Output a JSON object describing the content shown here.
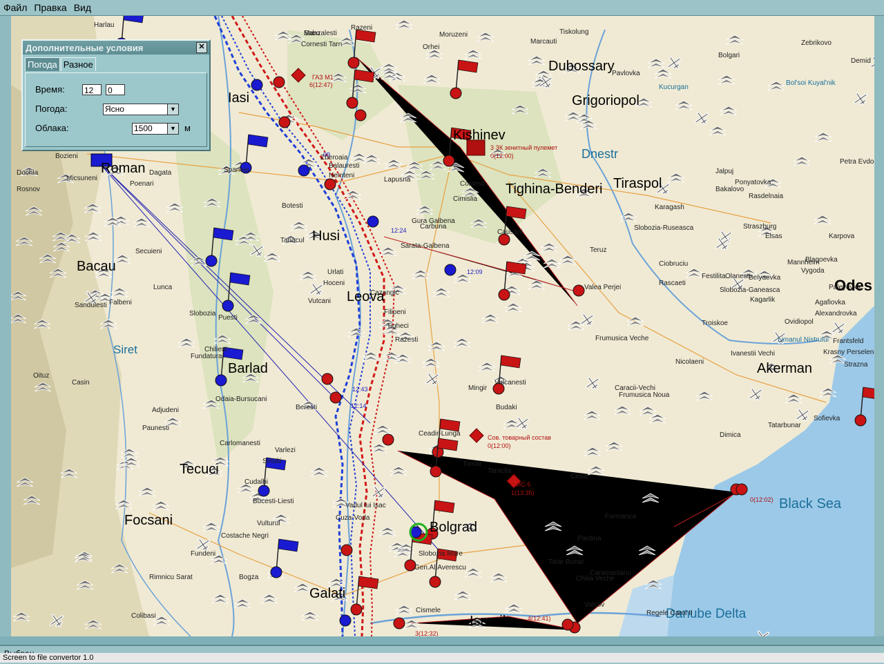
{
  "menu": [
    "Файл",
    "Правка",
    "Вид"
  ],
  "dialog": {
    "title": "Дополнительные условия",
    "close": "✕",
    "tabs": [
      "Погода",
      "Разное"
    ],
    "time_label": "Время:",
    "time_hours": "12",
    "time_minutes": "0",
    "weather_label": "Погода:",
    "weather_value": "Ясно",
    "clouds_label": "Облака:",
    "clouds_value": "1500",
    "clouds_unit": "м"
  },
  "status": {
    "text": "Выбран",
    "hint": "Screen to file convertor 1.0"
  },
  "map": {
    "major": [
      "Iasi",
      "Roman",
      "Bacau",
      "Husi",
      "Leova",
      "Barlad",
      "Tecuci",
      "Focsani",
      "Galati",
      "Bolgrad",
      "Ismail",
      "Kishinev",
      "Tighina-Benderi",
      "Tiraspol",
      "Dubossary",
      "Grigoriopol",
      "Akerman",
      "Odes"
    ],
    "water": [
      "Dnestr",
      "Black Sea",
      "Danube Delta",
      "Siret",
      "Limanul Nistrului",
      "Kucurgan",
      "Bol'soi Kuyal'nik"
    ],
    "small": [
      "Manzalesti",
      "Cornesti Tarn",
      "Razeni",
      "Tiskolung",
      "Marcauti",
      "Moruzeni",
      "Orhei",
      "Pavlovka",
      "Bolgari",
      "Zebrikovo",
      "Demid",
      "Harlau",
      "Bozieni",
      "Dochia",
      "Rosnov",
      "Micsuneni",
      "Dagata",
      "Poenari",
      "Spaneia",
      "Zberoaia",
      "Balauresti",
      "Nemteni",
      "Lapusna",
      "Costesti",
      "Cimislia",
      "Gura Galbena",
      "Botesti",
      "Tanacul",
      "Urlati",
      "Hoceni",
      "Vutcani",
      "Filipeni",
      "Cazangic",
      "Tigheci",
      "Razesti",
      "Secuieni",
      "Lunca",
      "Slobozia",
      "Puesti",
      "Sandulesti",
      "Falbeni",
      "Fundatura",
      "Chilieni",
      "Oituz",
      "Casin",
      "Adjudeni",
      "Odaia-Bursucani",
      "Beresti",
      "Paunesti",
      "Carlomanesti",
      "Varlezi",
      "Smulti",
      "Cudalbi",
      "Bucesti-Liesti",
      "Costache Negri",
      "Vulturul",
      "Fundeni",
      "Bogza",
      "Rimnicu Sarat",
      "Colibasi",
      "Vadul lui Isac",
      "Cuza-Voda",
      "Slobozia Mare",
      "Gen.Al.Averescu",
      "Cismele",
      "Furmanca",
      "Pardina",
      "Caramanlanu",
      "Chilia Veche",
      "Valcov",
      "Regele Carol II",
      "Tatar Bunar",
      "Ciisia",
      "Taraclia",
      "Tomai",
      "Vulcanesti",
      "Budaki",
      "Sofievka",
      "Dimica",
      "Tatarbunar",
      "Kagarlik",
      "Mannheim",
      "Elsas",
      "Karpova",
      "Straszburg",
      "Slobozia-Ruseasca",
      "Karagash",
      "Ciobruciu",
      "Rascaeti",
      "Festilita",
      "Slobozia-Ganeasca",
      "Olanesti",
      "Belyaevka",
      "Troiskoe",
      "Ivanestii Vechi",
      "Caracii-Vechi",
      "Frumusica Noua",
      "Frumusica Veche",
      "Nicolaeni",
      "Valea Perjei",
      "Teruz",
      "Causani",
      "Carbuna",
      "Sarata-Galbena",
      "Mingir",
      "Ceadir-Lunga",
      "Jalpuj",
      "Ponyatovka",
      "Bakalovo",
      "Rasdelnaia",
      "Petra Evdokievka",
      "Blagoevka",
      "Vygoda",
      "Paleyevka",
      "Agafiovka",
      "Krasny Perselenet",
      "Ovidiopol",
      "Frantsfeld",
      "Alexandrovka",
      "Strazna",
      "Sabo"
    ],
    "red_tags": [
      "ГАЗ М1",
      "6(12:47)",
      "Сов. товарный состав",
      "0(12:00)",
      "3 ИС-5",
      "1(13:35)",
      "0(12:02)",
      "4(12:41)",
      "3(12:32)",
      "3 ЗК зенитный пулемет",
      "0(12:00)"
    ],
    "blue_tags": [
      "09",
      "12:24",
      "12:09",
      "12:14",
      "12:43"
    ]
  }
}
